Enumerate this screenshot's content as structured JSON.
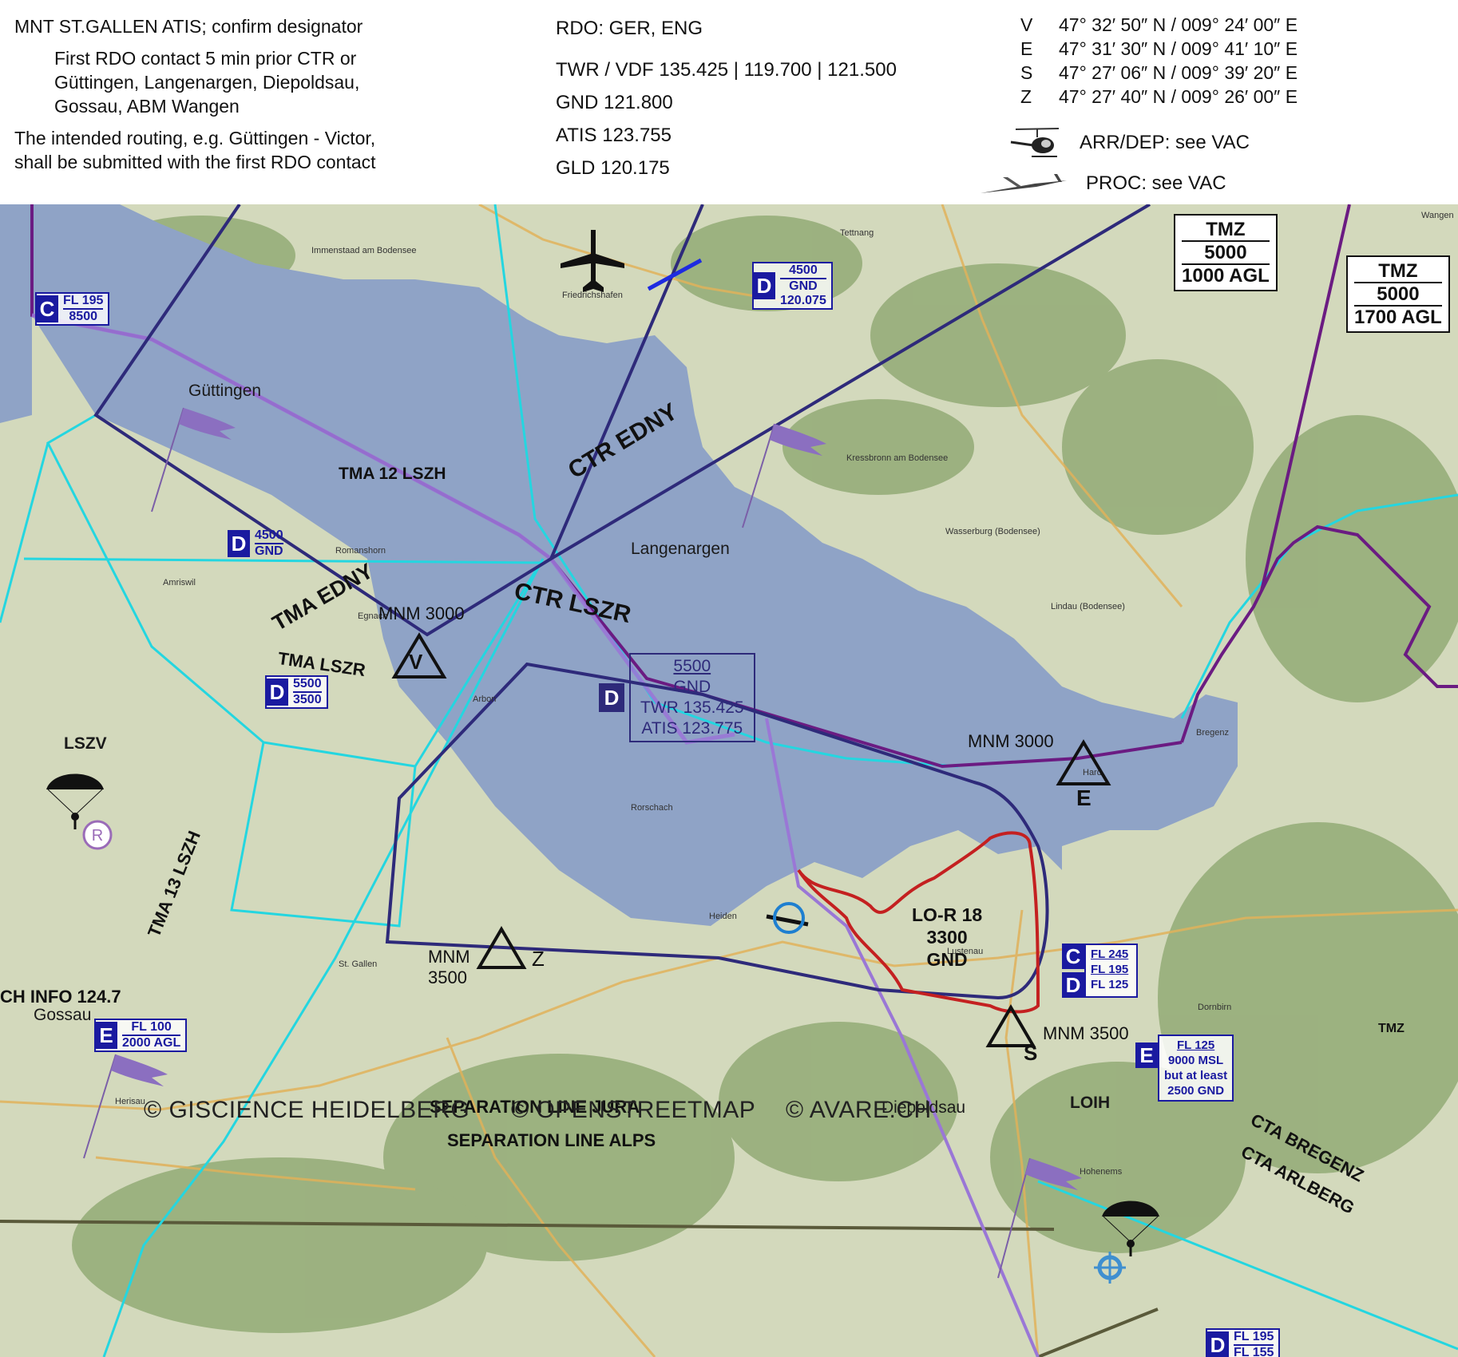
{
  "header": {
    "left": {
      "line1": "MNT ST.GALLEN ATIS; confirm designator",
      "contact": [
        "First RDO contact 5 min prior CTR or",
        "Güttingen, Langenargen, Diepoldsau,",
        "Gossau, ABM Wangen"
      ],
      "routing": [
        "The intended routing, e.g. Güttingen - Victor,",
        "shall be submitted with the first RDO contact"
      ]
    },
    "mid": {
      "rdo": "RDO: GER, ENG",
      "twr": "TWR / VDF  135.425 | 119.700 | 121.500",
      "gnd": "GND  121.800",
      "atis": "ATIS  123.755",
      "gld": "GLD   120.175"
    },
    "coords": [
      {
        "id": "V",
        "value": "47° 32′ 50″ N / 009° 24′ 00″ E"
      },
      {
        "id": "E",
        "value": "47° 31′ 30″ N / 009° 41′ 10″ E"
      },
      {
        "id": "S",
        "value": "47° 27′ 06″ N / 009° 39′ 20″ E"
      },
      {
        "id": "Z",
        "value": "47° 27′ 40″ N / 009° 26′ 00″ E"
      }
    ],
    "arr_dep": "ARR/DEP: see VAC",
    "proc": "PROC: see VAC"
  },
  "map": {
    "places": {
      "guttingen": "Güttingen",
      "langenargen": "Langenargen",
      "gossau": "Gossau",
      "diepoldsau": "Diepoldsau",
      "friedrichshafen": "Friedrichshafen",
      "bregenz": "Bregenz",
      "st_gallen": "St. Gallen",
      "lindau": "Lindau (Bodensee)",
      "lszv": "LSZV",
      "loih": "LOIH",
      "wangen": "Wangen",
      "arbon": "Arbon",
      "rorschach": "Rorschach",
      "tettnang": "Tettnang",
      "hard": "Hard",
      "lustenau": "Lustenau",
      "dornbirn": "Dornbirn",
      "heiden": "Heiden",
      "amriswil": "Amriswil",
      "romanshorn": "Romanshorn",
      "egnach": "Egnach",
      "kressbronn": "Kressbronn am Bodensee",
      "wasserburg": "Wasserburg (Bodensee)",
      "meersburg": "Immenstaad am Bodensee",
      "herisau": "Herisau",
      "hohenems": "Hohenems"
    },
    "airspace": {
      "tma12": "TMA 12 LSZH",
      "tma13": "TMA 13 LSZH",
      "tma_edny": "TMA EDNY",
      "tma_lszr": "TMA LSZR",
      "ctr_edny": "CTR EDNY",
      "ctr_lszr": "CTR LSZR",
      "lor18": [
        "LO-R 18",
        "3300",
        "GND"
      ],
      "ch_info": "CH INFO 124.7",
      "sep_jura": "SEPARATION LINE JURA",
      "sep_alps": "SEPARATION LINE ALPS",
      "cta_bregenz": "CTA BREGENZ",
      "cta_arlberg": "CTA ARLBERG"
    },
    "reporting_points": {
      "v": {
        "name": "V",
        "mnm": "MNM 3000"
      },
      "e": {
        "name": "E",
        "mnm": "MNM 3000"
      },
      "z": {
        "name": "Z",
        "mnm": "MNM\n3500"
      },
      "s": {
        "name": "S",
        "mnm": "MNM 3500"
      }
    },
    "class_boxes": {
      "c_fl195": {
        "class": "C",
        "upper": "FL 195",
        "lower": "8500"
      },
      "d_4500_120": {
        "class": "D",
        "upper": "4500",
        "lower": "GND",
        "freq": "120.075"
      },
      "d_4500_gnd": {
        "class": "D",
        "upper": "4500",
        "lower": "GND"
      },
      "d_5500_3500": {
        "class": "D",
        "upper": "5500",
        "lower": "3500"
      },
      "d_ctr": {
        "class": "D",
        "upper": "5500",
        "lower": "GND",
        "twr": "TWR 135.425",
        "atis": "ATIS 123.775"
      },
      "e_fl100": {
        "class": "E",
        "upper": "FL 100",
        "lower": "2000 AGL"
      },
      "cd_stack": {
        "c": "C",
        "d": "D",
        "l1": "FL 245",
        "l2": "FL 195",
        "l3": "FL 125"
      },
      "e_fl125": {
        "class": "E",
        "l1": "FL 125",
        "l2": "9000 MSL",
        "l3": "but at least",
        "l4": "2500 GND"
      },
      "d_fl195": {
        "class": "D",
        "upper": "FL 195",
        "lower": "FL 155"
      }
    },
    "tmz_1000": {
      "title": "TMZ",
      "alt": "5000",
      "base": "1000 AGL"
    },
    "tmz_1700": {
      "title": "TMZ",
      "alt": "5000",
      "base": "1700 AGL"
    },
    "tmz_small": "TMZ",
    "copyright": {
      "giscience": "© GISCIENCE HEIDELBERG",
      "osm": "© OPENSTREETMAP",
      "avare": "© AVARE.CH"
    }
  },
  "colors": {
    "lake": "#8fa3c6",
    "terrain": "#cfd6b8",
    "forest": "#7f9a62",
    "ctr_navy": "#2e2a7a",
    "fir_purple": "#6b1b82",
    "tma_cyan": "#24d6e0",
    "restricted_red": "#c42020",
    "class_blue": "#1a1aa0"
  }
}
